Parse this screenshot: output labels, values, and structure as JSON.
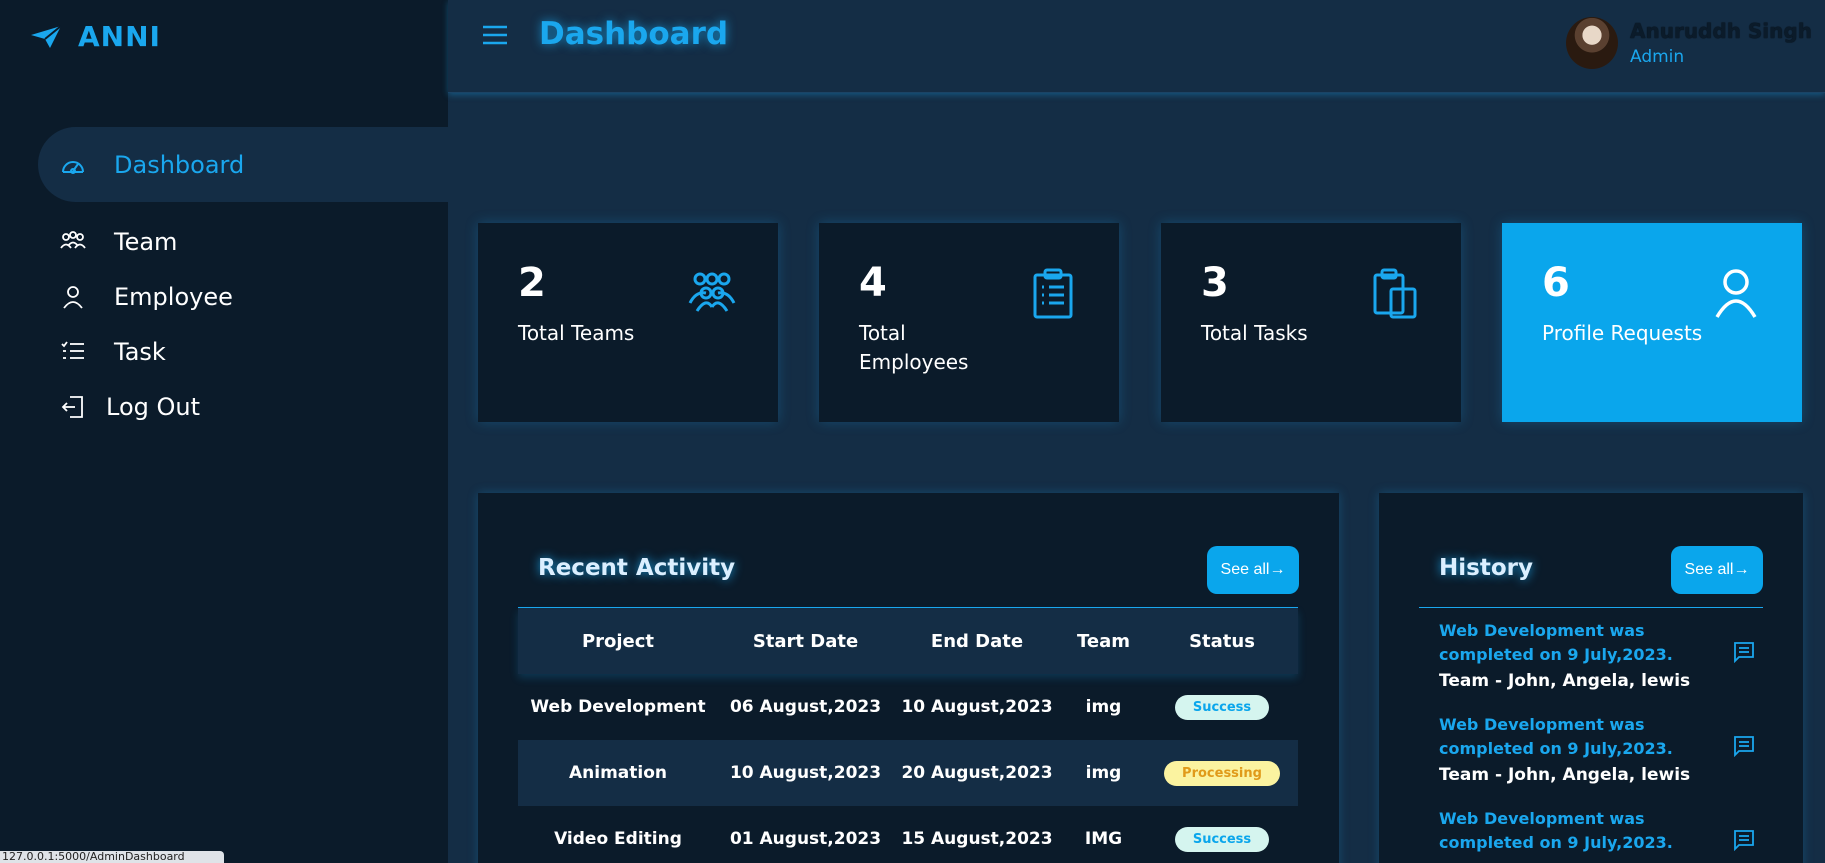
{
  "brand": {
    "name": "ANNI",
    "logo_icon": "paper-plane-icon"
  },
  "sidebar": {
    "items": [
      {
        "label": "Dashboard",
        "icon": "gauge-icon",
        "active": true
      },
      {
        "label": "Team",
        "icon": "team-icon"
      },
      {
        "label": "Employee",
        "icon": "user-icon"
      },
      {
        "label": "Task",
        "icon": "checklist-icon"
      },
      {
        "label": "Log Out",
        "icon": "logout-icon"
      }
    ]
  },
  "header": {
    "title": "Dashboard",
    "menu_icon": "hamburger-icon"
  },
  "user": {
    "name": "Anuruddh Singh",
    "role": "Admin"
  },
  "stats": [
    {
      "value": "2",
      "label": "Total Teams",
      "icon": "team-icon"
    },
    {
      "value": "4",
      "label": "Total Employees",
      "icon": "clipboard-list-icon"
    },
    {
      "value": "3",
      "label": "Total Tasks",
      "icon": "clipboard-copy-icon"
    },
    {
      "value": "6",
      "label": "Profile Requests",
      "icon": "user-icon"
    }
  ],
  "activity": {
    "title": "Recent Activity",
    "see_all": "See all→",
    "columns": [
      "Project",
      "Start Date",
      "End Date",
      "Team",
      "Status"
    ],
    "rows": [
      {
        "project": "Web Development",
        "start": "06 August,2023",
        "end": "10 August,2023",
        "team": "img",
        "status": "Success"
      },
      {
        "project": "Animation",
        "start": "10 August,2023",
        "end": "20 August,2023",
        "team": "img",
        "status": "Processing"
      },
      {
        "project": "Video Editing",
        "start": "01 August,2023",
        "end": "15 August,2023",
        "team": "IMG",
        "status": "Success"
      }
    ]
  },
  "history": {
    "title": "History",
    "see_all": "See all→",
    "items": [
      {
        "text": "Web Development was completed on 9 July,2023.",
        "team": "Team - John, Angela, lewis"
      },
      {
        "text": "Web Development was completed on 9 July,2023.",
        "team": "Team - John, Angela, lewis"
      },
      {
        "text": "Web Development was completed on 9 July,2023.",
        "team": ""
      }
    ]
  },
  "status_bar": {
    "url": "127.0.0.1:5000/AdminDashboard"
  },
  "colors": {
    "accent": "#1aa7ee",
    "sidebar_bg": "#0b1b2a",
    "main_bg": "#142d45",
    "success_bg": "#d5f5ef",
    "processing_bg": "#fbf3a0"
  }
}
